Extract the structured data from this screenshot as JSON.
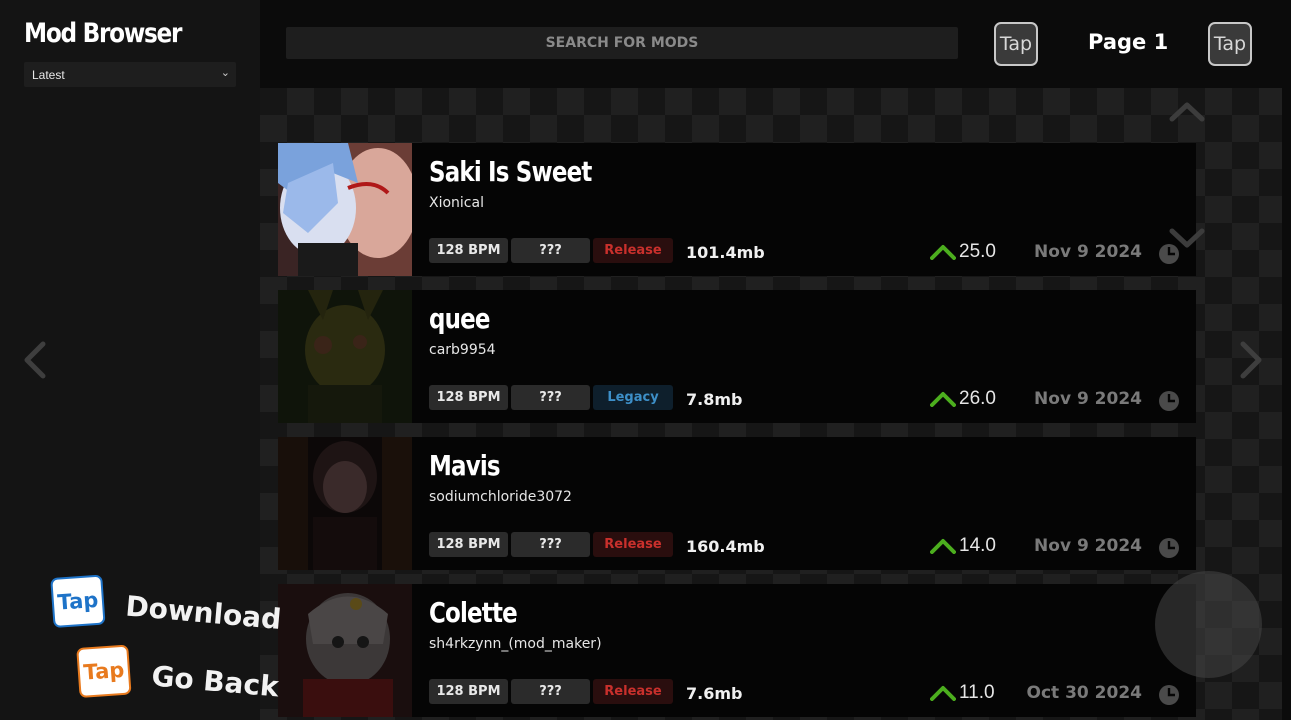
{
  "sidebar": {
    "title": "Mod Browser",
    "sort": {
      "selected": "Latest"
    }
  },
  "header": {
    "search_placeholder": "SEARCH FOR MODS",
    "prev_tap_label": "Tap",
    "page_label": "Page 1",
    "next_tap_label": "Tap"
  },
  "mods": [
    {
      "title": "Saki Is Sweet",
      "author": "Xionical",
      "bpm": "128 BPM",
      "difficulty": "???",
      "status": "Release",
      "size": "101.4mb",
      "votes": "25.0",
      "date": "Nov 9 2024"
    },
    {
      "title": "quee",
      "author": "carb9954",
      "bpm": "128 BPM",
      "difficulty": "???",
      "status": "Legacy",
      "size": "7.8mb",
      "votes": "26.0",
      "date": "Nov 9 2024"
    },
    {
      "title": "Mavis",
      "author": "sodiumchloride3072",
      "bpm": "128 BPM",
      "difficulty": "???",
      "status": "Release",
      "size": "160.4mb",
      "votes": "14.0",
      "date": "Nov 9 2024"
    },
    {
      "title": "Colette",
      "author": "sh4rkzynn_(mod_maker)",
      "bpm": "128 BPM",
      "difficulty": "???",
      "status": "Release",
      "size": "7.6mb",
      "votes": "11.0",
      "date": "Oct 30 2024"
    }
  ],
  "hints": {
    "download": {
      "tap": "Tap",
      "label": "Download",
      "color": "#1e73c8"
    },
    "back": {
      "tap": "Tap",
      "label": "Go Back",
      "color": "#e87a1e"
    }
  },
  "colors": {
    "release": "#c9302c",
    "legacy": "#3d8fc8",
    "upvote": "#4cae1e"
  }
}
